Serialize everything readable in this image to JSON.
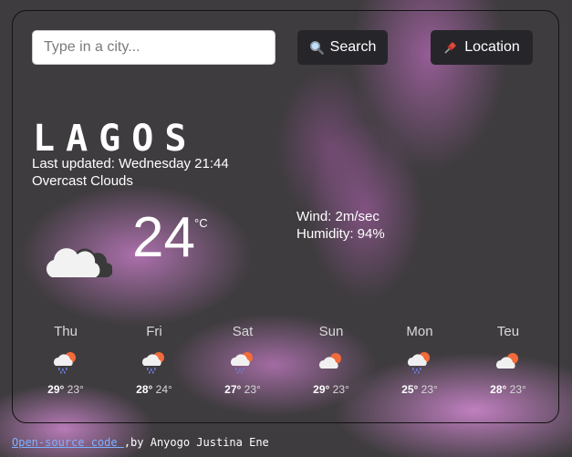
{
  "search": {
    "placeholder": "Type in a city...",
    "search_label": "Search",
    "location_label": "Location",
    "search_icon": "magnifier-icon",
    "location_icon": "pushpin-icon"
  },
  "current": {
    "city": "LAGOS",
    "last_updated": "Last updated: Wednesday 21:44",
    "description": "Overcast Clouds",
    "temperature": "24",
    "unit": "°C",
    "wind": "Wind: 2m/sec",
    "humidity": "Humidity: 94%",
    "icon": "overcast-clouds-icon"
  },
  "forecast": [
    {
      "day": "Thu",
      "max": "29°",
      "min": "23°",
      "icon": "rain-cloud-sun-icon"
    },
    {
      "day": "Fri",
      "max": "28°",
      "min": "24°",
      "icon": "rain-cloud-sun-icon"
    },
    {
      "day": "Sat",
      "max": "27°",
      "min": "23°",
      "icon": "rain-cloud-sun-icon"
    },
    {
      "day": "Sun",
      "max": "29°",
      "min": "23°",
      "icon": "cloud-sun-icon"
    },
    {
      "day": "Mon",
      "max": "25°",
      "min": "23°",
      "icon": "rain-cloud-sun-icon"
    },
    {
      "day": "Teu",
      "max": "28°",
      "min": "23°",
      "icon": "cloud-sun-icon"
    }
  ],
  "footer": {
    "link_text": "Open-source code ",
    "author_text": ",by Anyogo Justina Ene"
  },
  "colors": {
    "button_bg": "#26262a",
    "link": "#7fb0ff",
    "sun": "#f26b3a"
  }
}
